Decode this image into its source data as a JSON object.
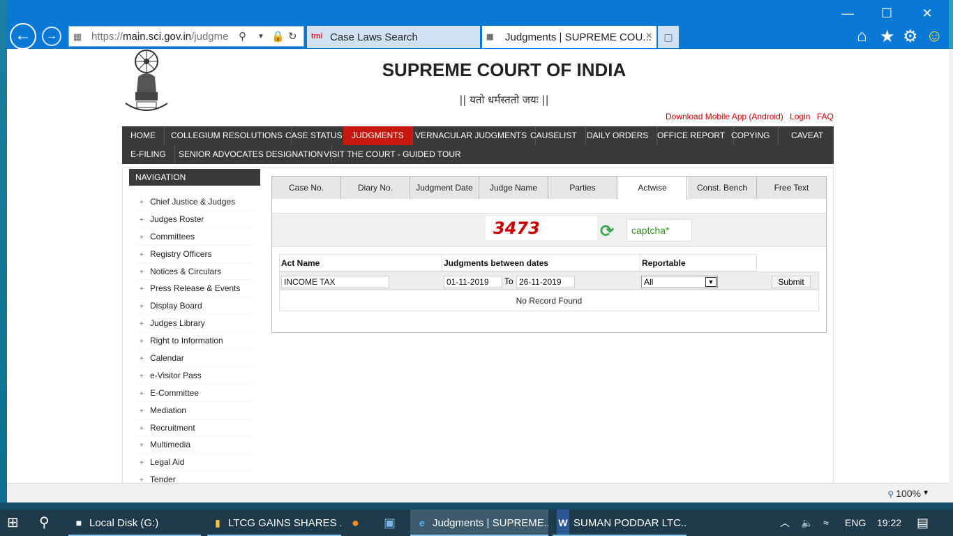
{
  "browser": {
    "url_prefix": "https://",
    "url_main": "main.sci.gov.in",
    "url_rest": "/judgme",
    "tab1_title": "Case Laws Search",
    "tab1_icon": "tmi",
    "tab2_title": "Judgments | SUPREME COU...",
    "tab2_close": "×",
    "window_minimize": "—",
    "window_maximize": "☐",
    "window_close": "✕"
  },
  "site": {
    "title": "SUPREME COURT OF INDIA",
    "motto": "|| यतो धर्मस्ततो जयः ||",
    "top_links": [
      "Download Mobile App (Android)",
      "Login",
      "FAQ"
    ]
  },
  "main_nav": {
    "row1": [
      "HOME",
      "COLLEGIUM RESOLUTIONS",
      "CASE STATUS",
      "JUDGMENTS",
      "VERNACULAR JUDGMENTS",
      "CAUSELIST",
      "DAILY ORDERS",
      "OFFICE REPORT",
      "COPYING",
      "CAVEAT"
    ],
    "row2": [
      "E-FILING",
      "SENIOR ADVOCATES DESIGNATION",
      "VISIT THE COURT - GUIDED TOUR"
    ],
    "active": "JUDGMENTS"
  },
  "sidebar": {
    "heading": "NAVIGATION",
    "items": [
      "Chief Justice & Judges",
      "Judges Roster",
      "Committees",
      "Registry Officers",
      "Notices & Circulars",
      "Press Release & Events",
      "Display Board",
      "Judges Library",
      "Right to Information",
      "Calendar",
      "e-Visitor Pass",
      "E-Committee",
      "Mediation",
      "Recruitment",
      "Multimedia",
      "Legal Aid",
      "Tender"
    ]
  },
  "search_tabs": {
    "items": [
      "Case No.",
      "Diary No.",
      "Judgment Date",
      "Judge Name",
      "Parties",
      "Actwise",
      "Const. Bench",
      "Free Text"
    ],
    "active": "Actwise"
  },
  "captcha": {
    "code": "3473",
    "placeholder": "captcha*"
  },
  "form": {
    "act_name_label": "Act Name",
    "dates_label": "Judgments between dates",
    "reportable_label": "Reportable",
    "act_name_value": "INCOME TAX",
    "date_from": "01-11-2019",
    "to_label": "To",
    "date_to": "26-11-2019",
    "reportable_value": "All",
    "submit_label": "Submit",
    "result_message": "No Record Found"
  },
  "status_bar": {
    "zoom": "100%"
  },
  "taskbar": {
    "apps": [
      {
        "label": "Local Disk (G:)",
        "icon": "drive-icon"
      },
      {
        "label": "LTCG GAINS SHARES ...",
        "icon": "folder-icon"
      },
      {
        "label": "Judgments | SUPREME...",
        "icon": "ie-icon"
      },
      {
        "label": "SUMAN PODDAR LTC...",
        "icon": "word-icon"
      }
    ],
    "language": "ENG",
    "time": "19:22"
  }
}
